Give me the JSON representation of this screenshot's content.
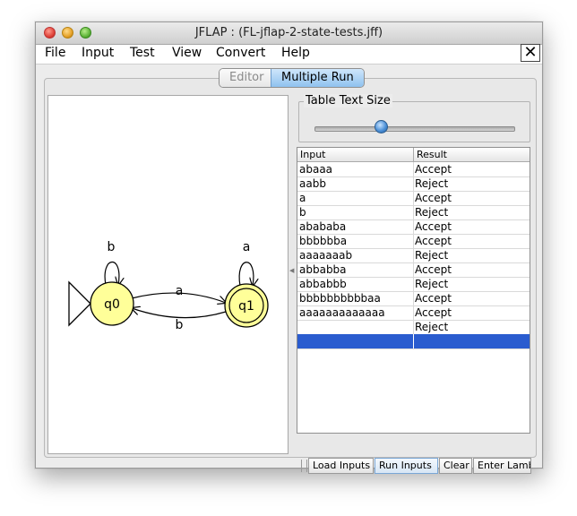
{
  "window": {
    "title": "JFLAP : (FL-jflap-2-state-tests.jff)",
    "close_mark": "✕"
  },
  "menu": [
    "File",
    "Input",
    "Test",
    "View",
    "Convert",
    "Help"
  ],
  "tabs": {
    "editor": "Editor",
    "multiple_run": "Multiple Run",
    "active": "Multiple Run"
  },
  "automaton": {
    "states": [
      {
        "name": "q0",
        "initial": true,
        "final": false
      },
      {
        "name": "q1",
        "initial": false,
        "final": true
      }
    ],
    "transitions": [
      {
        "from": "q0",
        "to": "q0",
        "label": "b"
      },
      {
        "from": "q0",
        "to": "q1",
        "label": "a"
      },
      {
        "from": "q1",
        "to": "q0",
        "label": "b"
      },
      {
        "from": "q1",
        "to": "q1",
        "label": "a"
      }
    ],
    "state_fill": "#ffff99"
  },
  "slider": {
    "title": "Table Text Size"
  },
  "table": {
    "headers": [
      "Input",
      "Result"
    ],
    "rows": [
      [
        "abaaa",
        "Accept"
      ],
      [
        "aabb",
        "Reject"
      ],
      [
        "a",
        "Accept"
      ],
      [
        "b",
        "Reject"
      ],
      [
        "abababa",
        "Accept"
      ],
      [
        "bbbbbba",
        "Accept"
      ],
      [
        "aaaaaaab",
        "Reject"
      ],
      [
        "abbabba",
        "Accept"
      ],
      [
        "abbabbb",
        "Reject"
      ],
      [
        "bbbbbbbbbbaa",
        "Accept"
      ],
      [
        "aaaaaaaaaaaaa",
        "Accept"
      ],
      [
        "",
        "Reject"
      ],
      [
        "",
        ""
      ]
    ],
    "selected_color": "#2a5ccf"
  },
  "buttons": {
    "load": "Load Inputs",
    "run": "Run Inputs",
    "clear": "Clear",
    "lambda": "Enter Lambda"
  }
}
